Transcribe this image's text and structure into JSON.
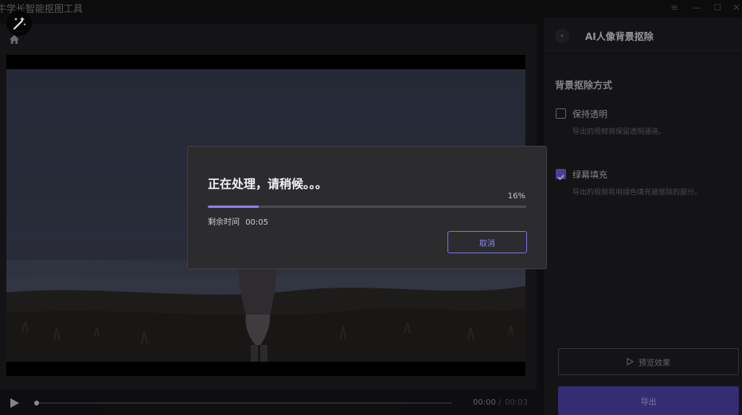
{
  "app": {
    "title": "牛学长智能抠图工具"
  },
  "window_controls": [
    "≡",
    "—",
    "☐",
    "✕"
  ],
  "player": {
    "current_time": "00:00",
    "separator": "/",
    "total_time": "00:03",
    "progress": 0
  },
  "side_panel": {
    "title": "AI人像背景抠除",
    "section_title": "背景抠除方式",
    "options": [
      {
        "label": "保持透明",
        "desc": "导出的视频将保留透明通道。",
        "checked": false
      },
      {
        "label": "绿幕填充",
        "desc": "导出的视频将用绿色填充被抠除的部分。",
        "checked": true
      }
    ],
    "preview_button": "预览效果",
    "export_button": "导出"
  },
  "dialog": {
    "title": "正在处理，请稍候。。。",
    "percent_text": "16%",
    "progress": 0.16,
    "remaining_label": "剩余时间",
    "remaining_time": "00:05",
    "cancel_button": "取消"
  },
  "colors": {
    "accent": "#8c7df0",
    "export_bg": "#4e3fa6",
    "panel_bg": "#1e1e21",
    "dialog_bg": "#2c2c2f"
  },
  "icons": {
    "logo": "magic-wand-icon",
    "home": "home-icon",
    "play": "play-icon",
    "back": "chevron-left-icon",
    "preview": "play-outline-icon"
  }
}
